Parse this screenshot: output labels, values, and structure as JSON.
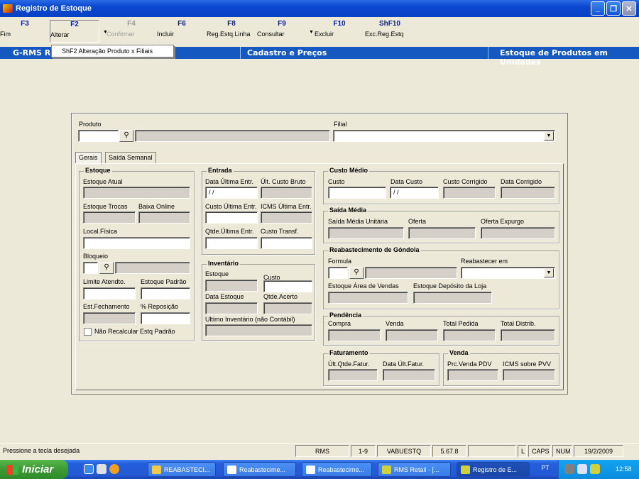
{
  "window": {
    "title": "Registro de Estoque"
  },
  "toolbar": {
    "buttons": [
      {
        "key": "F3",
        "label": "Fim"
      },
      {
        "key": "F2",
        "label": "Alterar"
      },
      {
        "key": "F4",
        "label": "Confirmar"
      },
      {
        "key": "F6",
        "label": "Incluir"
      },
      {
        "key": "F8",
        "label": "Reg.Estq.Linha"
      },
      {
        "key": "F9",
        "label": "Consultar"
      },
      {
        "key": "F10",
        "label": "Excluir"
      },
      {
        "key": "ShF10",
        "label": "Exc.Reg.Estq"
      }
    ],
    "dropdown_item": "ShF2  Alteração Produto x Filiais"
  },
  "headerbar": {
    "left": "G-RMS Re",
    "center": "Cadastro e Preços",
    "right": "Estoque de Produtos em Unidades"
  },
  "form": {
    "produto_label": "Produto",
    "filial_label": "Filial",
    "tabs": [
      "Gerais",
      "Saída Semanal"
    ],
    "estoque": {
      "title": "Estoque",
      "estoque_atual": "Estoque Atual",
      "estoque_trocas": "Estoque Trocas",
      "baixa_online": "Baixa Online",
      "local_fisica": "Local.Física",
      "bloqueio": "Bloqueio",
      "limite_atendto": "Limite Atendto.",
      "estoque_padrao": "Estoque Padrão",
      "est_fechamento": "Est.Fechamento",
      "pct_reposicao": "% Reposição",
      "nao_recalcular": "Não Recalcular Estq Padrão"
    },
    "entrada": {
      "title": "Entrada",
      "data_ultima_entr": "Data Última Entr.",
      "data_value": " / /",
      "ult_custo_bruto": "Últ. Custo Bruto",
      "custo_ultima_entr": "Custo Última Entr.",
      "icms_ultima_entr": "ICMS Última Entr.",
      "qtde_ultima_entr": "Qtde.Última Entr.",
      "custo_transf": "Custo Transf."
    },
    "inventario": {
      "title": "Inventário",
      "estoque": "Estoque",
      "custo": "Custo",
      "data_estoque": "Data Estoque",
      "qtde_acerto": "Qtde.Acerto",
      "ultimo_inventario": "Ultimo Inventário (não Contábil)"
    },
    "custo_medio": {
      "title": "Custo Médio",
      "custo": "Custo",
      "data_custo": "Data Custo",
      "data_value": " / /",
      "custo_corrigido": "Custo Corrigido",
      "data_corrigido": "Data Corrigido"
    },
    "saida_media": {
      "title": "Saída Média",
      "saida_media_unitaria": "Saída Média Unitária",
      "oferta": "Oferta",
      "oferta_expurgo": "Oferta Expurgo"
    },
    "reabastecimento": {
      "title": "Reabastecimento de Góndola",
      "formula": "Formula",
      "reabastecer_em": "Reabastecer em",
      "estoque_area_vendas": "Estoque Área de Vendas",
      "estoque_deposito": "Estoque Depósito da Loja"
    },
    "pendencia": {
      "title": "Pendência",
      "compra": "Compra",
      "venda": "Venda",
      "total_pedida": "Total Pedida",
      "total_distrib": "Total  Distrib."
    },
    "faturamento": {
      "title": "Faturamento",
      "ult_qtde_fatur": "Últ.Qtde.Fatur.",
      "data_ult_fatur": "Data Últ.Fatur."
    },
    "venda": {
      "title": "Venda",
      "prc_venda_pdv": "Prc.Venda PDV",
      "icms_sobre_pvv": "ICMS sobre PVV"
    }
  },
  "statusbar": {
    "message": "Pressione a tecla desejada",
    "panels": [
      "RMS",
      "1-9",
      "VABUESTQ",
      "5.67.8",
      "",
      "L",
      "CAPS",
      "NUM",
      "19/2/2009"
    ]
  },
  "taskbar": {
    "start": "Iniciar",
    "tasks": [
      "REABASTECI...",
      "Reabastecime...",
      "Reabastecime...",
      "RMS Retail - [...",
      "Registro de E..."
    ],
    "lang": "PT",
    "time": "12:58"
  }
}
